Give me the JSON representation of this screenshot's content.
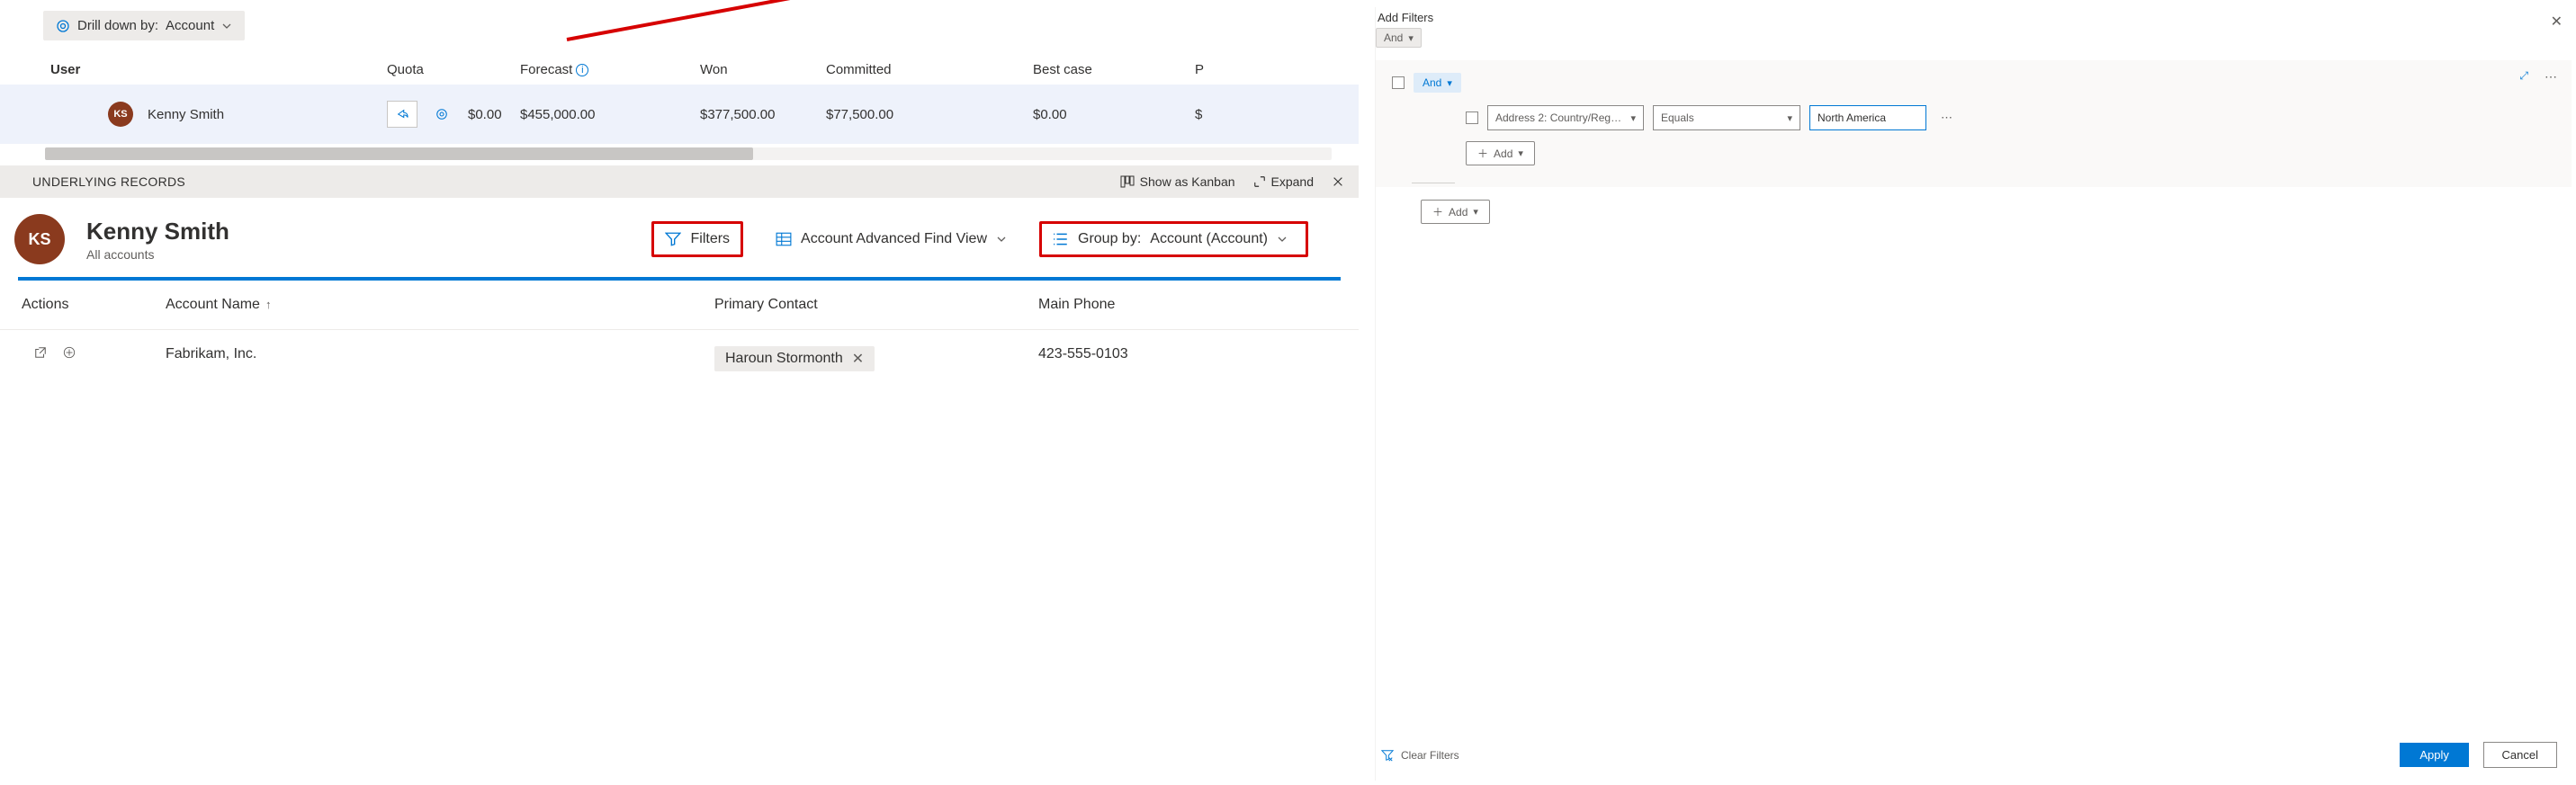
{
  "drilldown": {
    "prefix": "Drill down by:",
    "value": "Account"
  },
  "forecast": {
    "headers": {
      "user": "User",
      "quota": "Quota",
      "forecast": "Forecast",
      "won": "Won",
      "committed": "Committed",
      "bestcase": "Best case",
      "pipeline": "P"
    },
    "row": {
      "initials": "KS",
      "name": "Kenny Smith",
      "quota": "$0.00",
      "forecast": "$455,000.00",
      "won": "$377,500.00",
      "committed": "$77,500.00",
      "bestcase": "$0.00",
      "pipeline": "$"
    }
  },
  "underlying": {
    "title": "UNDERLYING RECORDS",
    "kanban": "Show as Kanban",
    "expand": "Expand"
  },
  "detail": {
    "initials": "KS",
    "name": "Kenny Smith",
    "subtitle": "All accounts",
    "filters": "Filters",
    "view": "Account Advanced Find View",
    "groupby_prefix": "Group by:",
    "groupby_value": "Account (Account)"
  },
  "grid": {
    "headers": {
      "actions": "Actions",
      "account": "Account Name",
      "contact": "Primary Contact",
      "phone": "Main Phone"
    },
    "row": {
      "account": "Fabrikam, Inc.",
      "contact": "Haroun Stormonth",
      "phone": "423-555-0103"
    }
  },
  "filter_panel": {
    "title": "Add Filters",
    "and": "And",
    "field": "Address 2: Country/Reg…",
    "operator": "Equals",
    "value": "North America",
    "add": "Add",
    "clear": "Clear Filters",
    "apply": "Apply",
    "cancel": "Cancel"
  }
}
